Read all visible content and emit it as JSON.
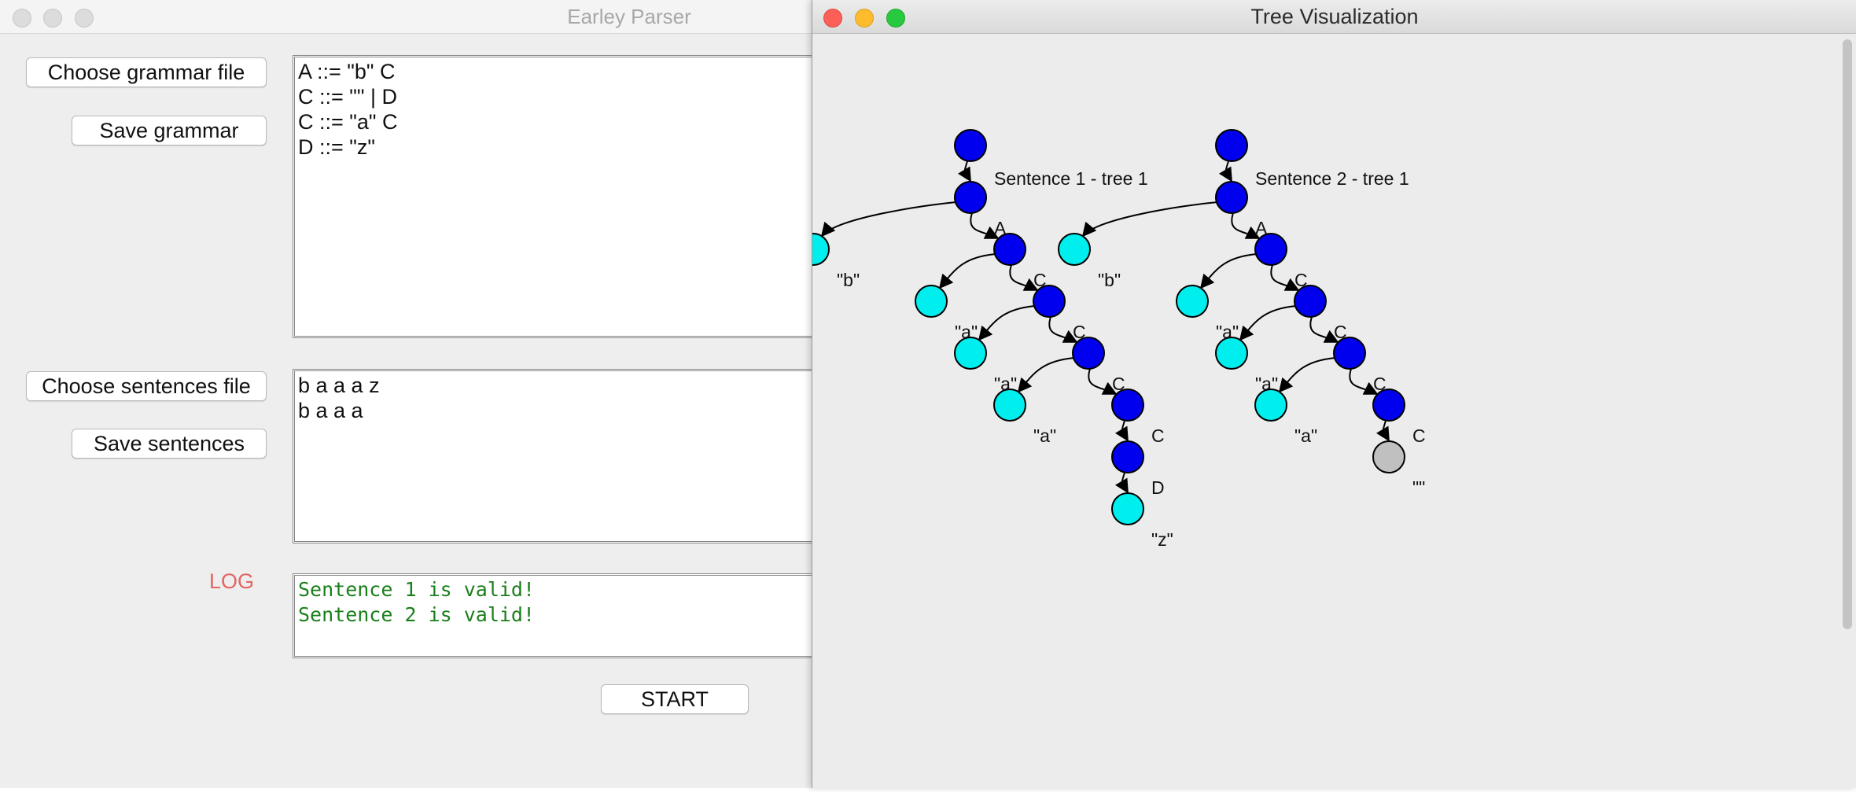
{
  "left_window": {
    "title": "Earley Parser",
    "choose_grammar_label": "Choose grammar file",
    "save_grammar_label": "Save grammar",
    "grammar_lines": [
      "A ::= \"b\" C",
      "C ::= \"\" | D",
      "C ::= \"a\" C",
      "D ::= \"z\""
    ],
    "choose_sentences_label": "Choose sentences file",
    "save_sentences_label": "Save sentences",
    "sentence_lines": [
      "b a a a z",
      "b a a a"
    ],
    "log_label": "LOG",
    "log_lines": [
      "Sentence 1 is valid!",
      "Sentence 2 is valid!"
    ],
    "start_label": "START"
  },
  "right_window": {
    "title": "Tree Visualization",
    "colors": {
      "nonterminal": "#0000ee",
      "terminal": "#00eeee",
      "empty": "#c0c0c0",
      "edge": "#000000"
    },
    "trees": [
      {
        "caption": "Sentence 1 - tree 1",
        "nodes": [
          {
            "kind": "nonterminal",
            "label": ""
          },
          {
            "kind": "nonterminal",
            "label": "A"
          },
          {
            "kind": "terminal",
            "label": "\"b\""
          },
          {
            "kind": "nonterminal",
            "label": "C"
          },
          {
            "kind": "terminal",
            "label": "\"a\""
          },
          {
            "kind": "nonterminal",
            "label": "C"
          },
          {
            "kind": "terminal",
            "label": "\"a\""
          },
          {
            "kind": "nonterminal",
            "label": "C"
          },
          {
            "kind": "terminal",
            "label": "\"a\""
          },
          {
            "kind": "nonterminal",
            "label": "C"
          },
          {
            "kind": "nonterminal",
            "label": "D"
          },
          {
            "kind": "terminal",
            "label": "\"z\""
          }
        ],
        "edges": [
          [
            0,
            1
          ],
          [
            1,
            2
          ],
          [
            1,
            3
          ],
          [
            3,
            4
          ],
          [
            3,
            5
          ],
          [
            5,
            6
          ],
          [
            5,
            7
          ],
          [
            7,
            8
          ],
          [
            7,
            9
          ],
          [
            9,
            10
          ],
          [
            10,
            11
          ]
        ]
      },
      {
        "caption": "Sentence 2 - tree 1",
        "nodes": [
          {
            "kind": "nonterminal",
            "label": ""
          },
          {
            "kind": "nonterminal",
            "label": "A"
          },
          {
            "kind": "terminal",
            "label": "\"b\""
          },
          {
            "kind": "nonterminal",
            "label": "C"
          },
          {
            "kind": "terminal",
            "label": "\"a\""
          },
          {
            "kind": "nonterminal",
            "label": "C"
          },
          {
            "kind": "terminal",
            "label": "\"a\""
          },
          {
            "kind": "nonterminal",
            "label": "C"
          },
          {
            "kind": "terminal",
            "label": "\"a\""
          },
          {
            "kind": "nonterminal",
            "label": "C"
          },
          {
            "kind": "empty",
            "label": "\"\""
          }
        ],
        "edges": [
          [
            0,
            1
          ],
          [
            1,
            2
          ],
          [
            1,
            3
          ],
          [
            3,
            4
          ],
          [
            3,
            5
          ],
          [
            5,
            6
          ],
          [
            5,
            7
          ],
          [
            7,
            8
          ],
          [
            7,
            9
          ],
          [
            9,
            10
          ]
        ]
      }
    ]
  }
}
